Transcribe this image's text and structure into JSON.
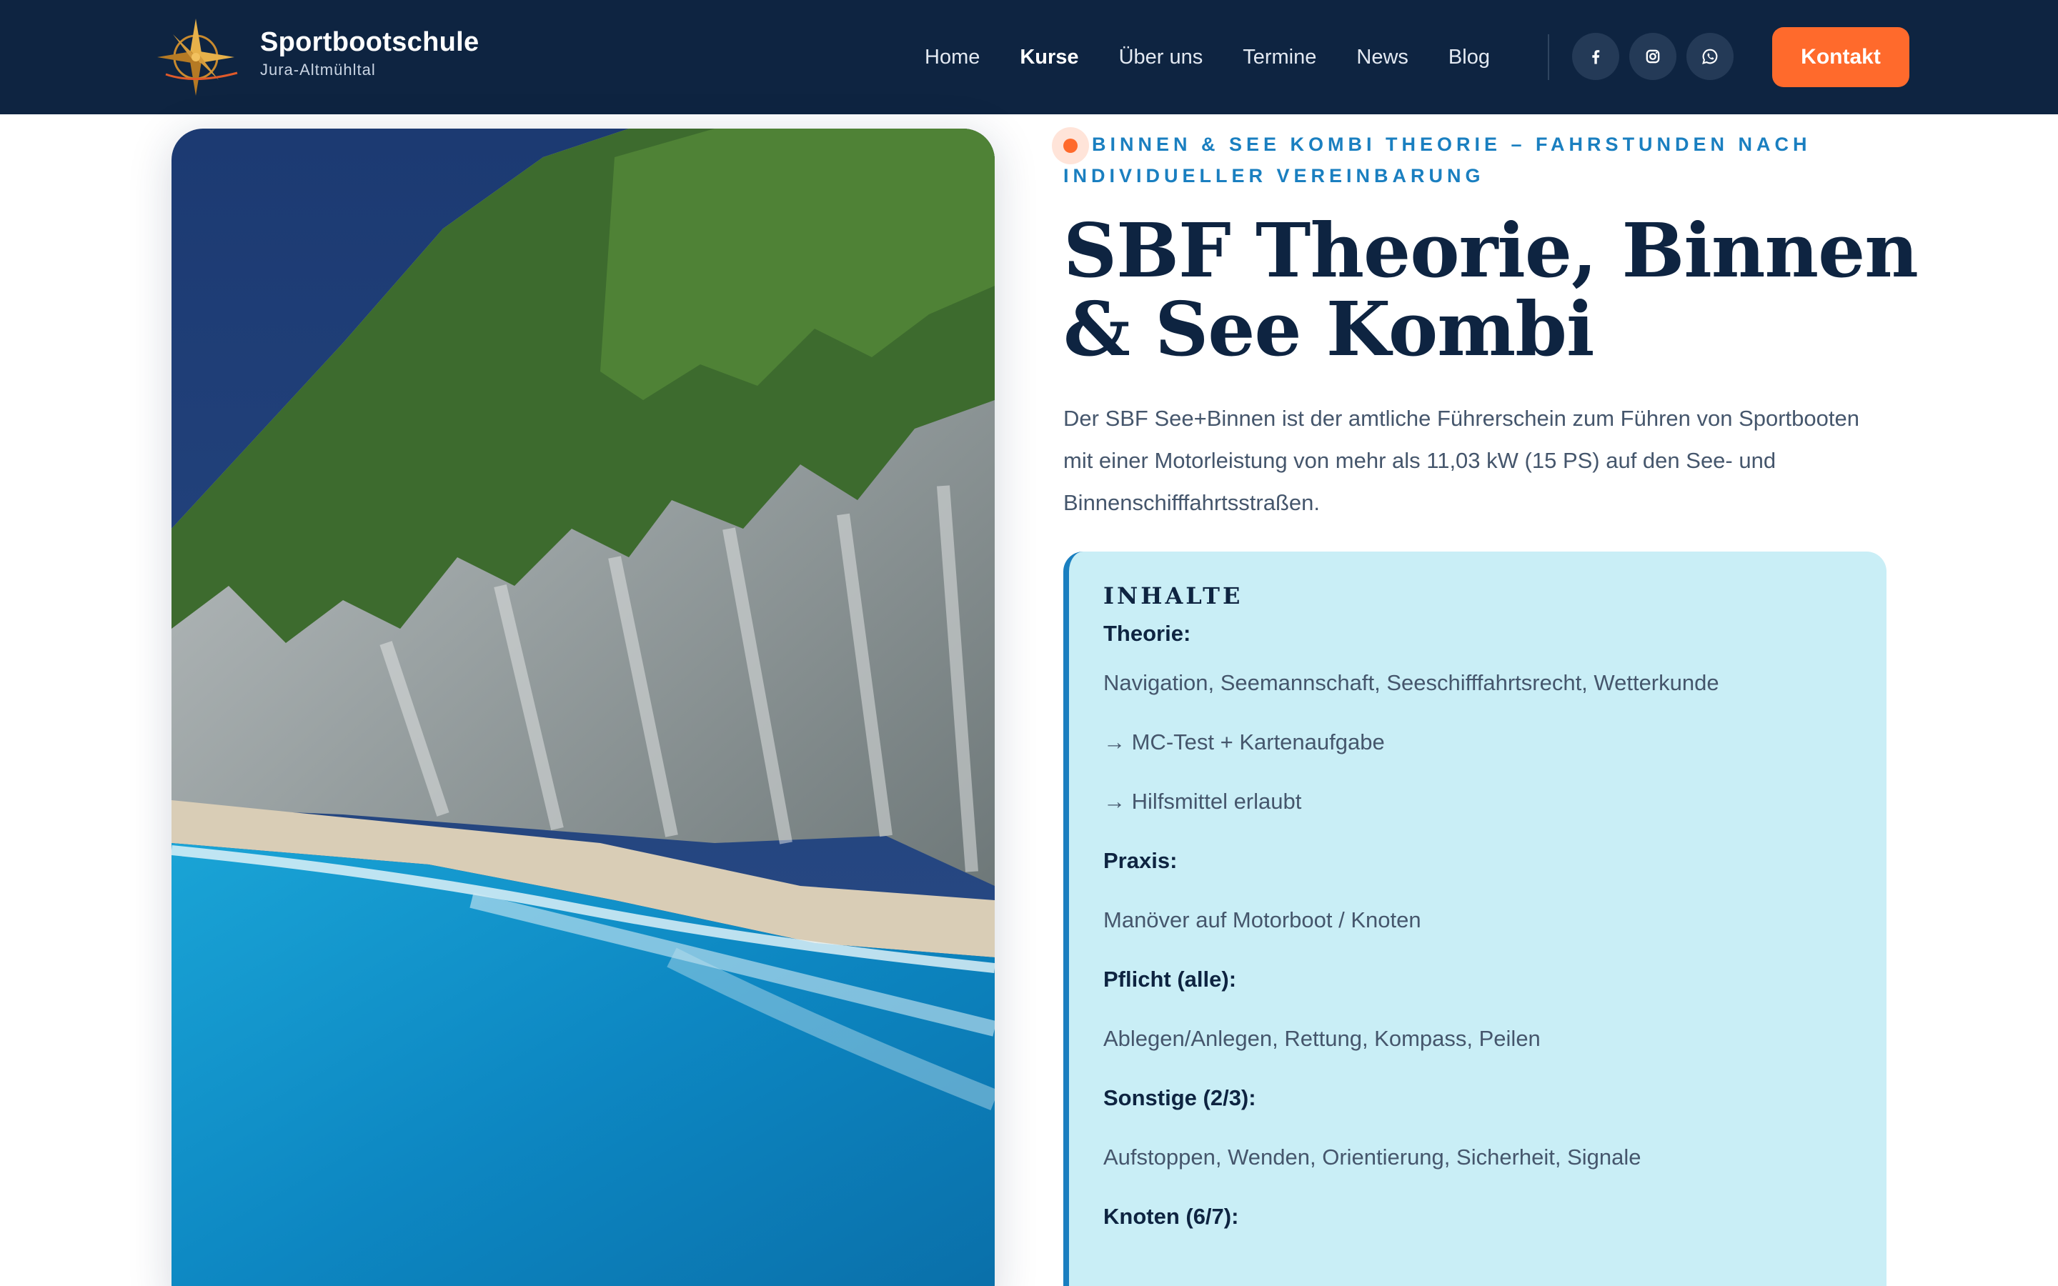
{
  "header": {
    "brand_title": "Sportbootschule",
    "brand_subtitle": "Jura-Altmühltal",
    "logo_icon": "compass-rose-icon",
    "nav": [
      {
        "label": "Home",
        "active": false
      },
      {
        "label": "Kurse",
        "active": true
      },
      {
        "label": "Über uns",
        "active": false
      },
      {
        "label": "Termine",
        "active": false
      },
      {
        "label": "News",
        "active": false
      },
      {
        "label": "Blog",
        "active": false
      }
    ],
    "social": [
      "facebook-icon",
      "instagram-icon",
      "whatsapp-icon"
    ],
    "contact_label": "Kontakt"
  },
  "hero": {
    "image_icon": "cliff-beach-photo"
  },
  "course": {
    "eyebrow": "Binnen & See Kombi Theorie – Fahrstunden nach individueller Vereinbarung",
    "title": "SBF Theorie, Binnen & See Kombi",
    "lead": "Der SBF See+Binnen ist der amtliche Führerschein zum Führen von Sportbooten mit einer Motorleistung von mehr als 11,03 kW (15 PS) auf den See- und Binnenschifffahrtsstraßen.",
    "contents": {
      "heading": "INHALTE",
      "items": [
        {
          "text": "Theorie:",
          "strong": true
        },
        {
          "text": "Navigation, Seemannschaft, Seeschifffahrtsrecht, Wetterkunde",
          "strong": false
        },
        {
          "text": "→ MC-Test + Kartenaufgabe",
          "strong": false
        },
        {
          "text": "→ Hilfsmittel erlaubt",
          "strong": false
        },
        {
          "text": "Praxis:",
          "strong": true
        },
        {
          "text": "Manöver auf Motorboot / Knoten",
          "strong": false
        },
        {
          "text": "Pflicht (alle):",
          "strong": true
        },
        {
          "text": "Ablegen/Anlegen, Rettung, Kompass, Peilen",
          "strong": false
        },
        {
          "text": "Sonstige (2/3):",
          "strong": true
        },
        {
          "text": "Aufstoppen, Wenden, Orientierung, Sicherheit, Signale",
          "strong": false
        },
        {
          "text": "Knoten (6/7):",
          "strong": true
        }
      ]
    }
  },
  "colors": {
    "header_bg": "#0e2441",
    "accent_orange": "#ff6a2c",
    "accent_blue": "#1a7fc0",
    "card_bg": "#c9eef6"
  }
}
